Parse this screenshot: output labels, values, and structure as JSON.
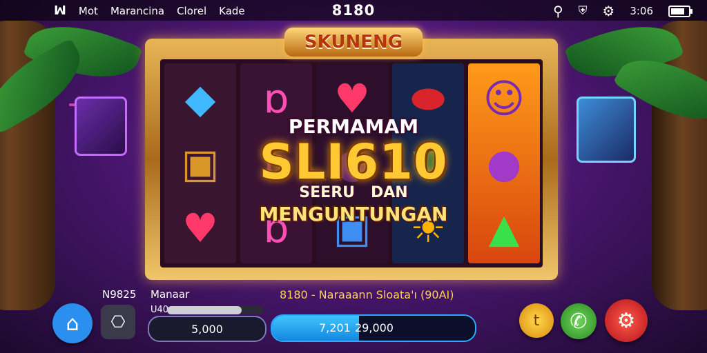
{
  "status_bar": {
    "left_items": [
      "Mot",
      "Marancina",
      "Clorel",
      "Kade"
    ],
    "center": "8180",
    "right_text": "3:06",
    "battery_level": 0.8
  },
  "game": {
    "logo": "SKUNENG",
    "promo_line1": "PERMAMAM",
    "promo_line2": "SLI610",
    "promo_line3": "SEERU   DAN",
    "promo_line4": "MENGUNTUNGAN",
    "reels": [
      [
        "blue-gem",
        "treasure-box",
        "strawberry"
      ],
      [
        "pink-token",
        "pink-token",
        "pink-token"
      ],
      [
        "strawberry",
        "purple-token",
        "blue-chest"
      ],
      [
        "red-cannon",
        "green-cup",
        "sun-face"
      ],
      [
        "cat-hero",
        "purple-drum",
        "green-bottle"
      ]
    ]
  },
  "bottom": {
    "label_left": "N9825",
    "label_mid": "Manaar",
    "sub_label": "U40",
    "bet_value": "5,000",
    "info_text": "8180 - Naraaann Sloata'ı (90AI)",
    "bar_left_value": "7,201",
    "bar_right_value": "29,000",
    "progress": 0.43,
    "coin_label": "t"
  },
  "colors": {
    "accent": "#ffc934",
    "frame": "#d69a3a",
    "home": "#2b8ff0",
    "spin": "#e12a2a",
    "call": "#3aa83a",
    "coin": "#f0b020"
  }
}
